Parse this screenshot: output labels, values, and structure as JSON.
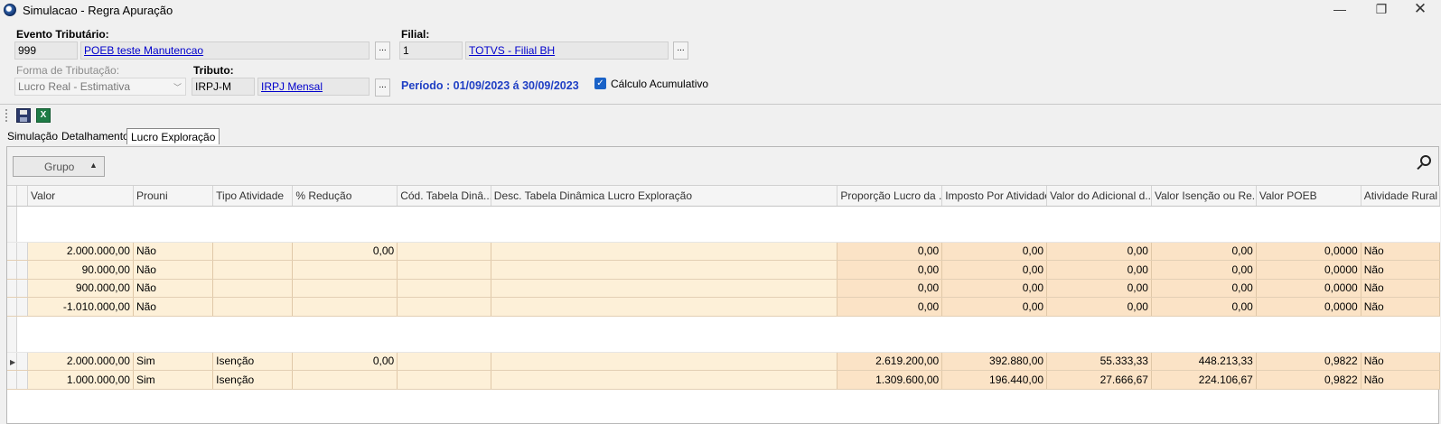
{
  "window": {
    "title": "Simulacao - Regra Apuração",
    "controls": {
      "minimize": "—",
      "maximize": "❐",
      "close": "✕"
    }
  },
  "form": {
    "evento": {
      "label": "Evento Tributário:",
      "code": "999",
      "name": "POEB teste Manutencao",
      "btn": "..."
    },
    "filial": {
      "label": "Filial:",
      "code": "1",
      "name": "TOTVS - Filial BH",
      "btn": "..."
    },
    "forma": {
      "label": "Forma de Tributação:",
      "value": "Lucro Real - Estimativa"
    },
    "tributo": {
      "label": "Tributo:",
      "code": "IRPJ-M",
      "name": "IRPJ Mensal",
      "btn": "..."
    },
    "periodo": "Período : 01/09/2023 á 30/09/2023",
    "calculo_acumulativo": {
      "label": "Cálculo Acumulativo",
      "checked": true
    }
  },
  "toolbar": {
    "save_icon": "save-icon",
    "excel_icon": "excel-icon",
    "excel_glyph": "X"
  },
  "tabs": [
    {
      "label": "Simulação",
      "active": false
    },
    {
      "label": "Detalhamento",
      "active": false
    },
    {
      "label": "Lucro Exploração",
      "active": true
    }
  ],
  "grid": {
    "group_button": "Grupo",
    "columns": [
      "Valor",
      "Prouni",
      "Tipo Atividade",
      "% Redução",
      "Cód. Tabela Dinâ...",
      "Desc. Tabela Dinâmica Lucro Exploração",
      "Proporção Lucro da ...",
      "Imposto Por Atividade",
      "Valor do Adicional d...",
      "Valor Isenção ou Re...",
      "Valor POEB",
      "Atividade Rural"
    ],
    "group1": [
      [
        "2.000.000,00",
        "Não",
        "",
        "0,00",
        "",
        "",
        "0,00",
        "0,00",
        "0,00",
        "0,00",
        "0,0000",
        "Não"
      ],
      [
        "90.000,00",
        "Não",
        "",
        "",
        "",
        "",
        "0,00",
        "0,00",
        "0,00",
        "0,00",
        "0,0000",
        "Não"
      ],
      [
        "900.000,00",
        "Não",
        "",
        "",
        "",
        "",
        "0,00",
        "0,00",
        "0,00",
        "0,00",
        "0,0000",
        "Não"
      ],
      [
        "-1.010.000,00",
        "Não",
        "",
        "",
        "",
        "",
        "0,00",
        "0,00",
        "0,00",
        "0,00",
        "0,0000",
        "Não"
      ]
    ],
    "group2": [
      [
        "2.000.000,00",
        "Sim",
        "Isenção",
        "0,00",
        "",
        "",
        "2.619.200,00",
        "392.880,00",
        "55.333,33",
        "448.213,33",
        "0,9822",
        "Não"
      ],
      [
        "1.000.000,00",
        "Sim",
        "Isenção",
        "",
        "",
        "",
        "1.309.600,00",
        "196.440,00",
        "27.666,67",
        "224.106,67",
        "0,9822",
        "Não"
      ]
    ],
    "current_row_marker": "▶"
  }
}
